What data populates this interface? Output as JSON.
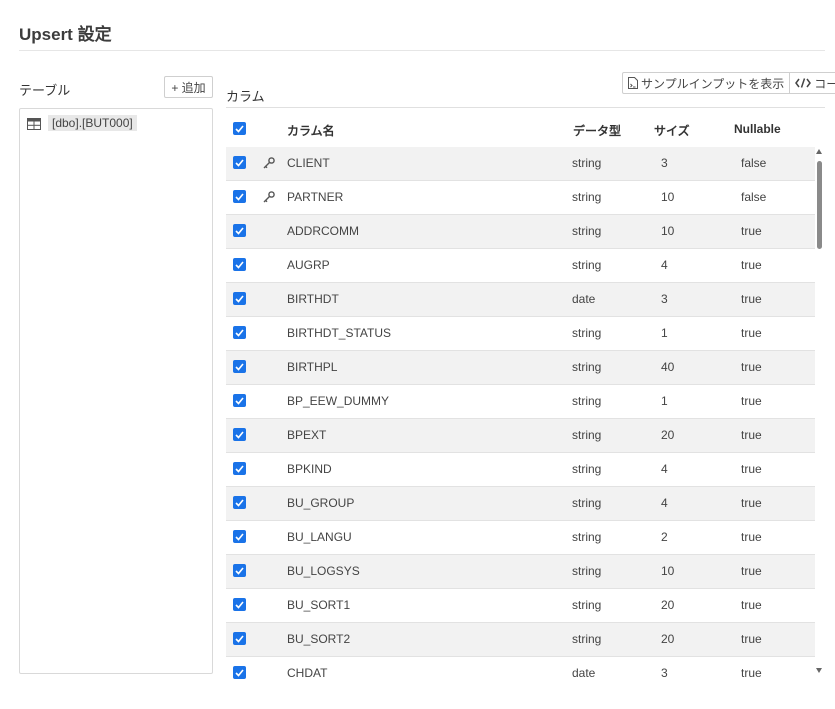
{
  "title": "Upsert 設定",
  "tables": {
    "label": "テーブル",
    "add_button": "+ 追加",
    "items": [
      "[dbo].[BUT000]"
    ]
  },
  "columns": {
    "label": "カラム",
    "sample_input_button": "サンプルインプットを表示",
    "code_button": "コード",
    "headers": {
      "name": "カラム名",
      "type": "データ型",
      "size": "サイズ",
      "nullable": "Nullable"
    },
    "rows": [
      {
        "name": "CLIENT",
        "type": "string",
        "size": "3",
        "nullable": "false",
        "key": true,
        "checked": true
      },
      {
        "name": "PARTNER",
        "type": "string",
        "size": "10",
        "nullable": "false",
        "key": true,
        "checked": true
      },
      {
        "name": "ADDRCOMM",
        "type": "string",
        "size": "10",
        "nullable": "true",
        "key": false,
        "checked": true
      },
      {
        "name": "AUGRP",
        "type": "string",
        "size": "4",
        "nullable": "true",
        "key": false,
        "checked": true
      },
      {
        "name": "BIRTHDT",
        "type": "date",
        "size": "3",
        "nullable": "true",
        "key": false,
        "checked": true
      },
      {
        "name": "BIRTHDT_STATUS",
        "type": "string",
        "size": "1",
        "nullable": "true",
        "key": false,
        "checked": true
      },
      {
        "name": "BIRTHPL",
        "type": "string",
        "size": "40",
        "nullable": "true",
        "key": false,
        "checked": true
      },
      {
        "name": "BP_EEW_DUMMY",
        "type": "string",
        "size": "1",
        "nullable": "true",
        "key": false,
        "checked": true
      },
      {
        "name": "BPEXT",
        "type": "string",
        "size": "20",
        "nullable": "true",
        "key": false,
        "checked": true
      },
      {
        "name": "BPKIND",
        "type": "string",
        "size": "4",
        "nullable": "true",
        "key": false,
        "checked": true
      },
      {
        "name": "BU_GROUP",
        "type": "string",
        "size": "4",
        "nullable": "true",
        "key": false,
        "checked": true
      },
      {
        "name": "BU_LANGU",
        "type": "string",
        "size": "2",
        "nullable": "true",
        "key": false,
        "checked": true
      },
      {
        "name": "BU_LOGSYS",
        "type": "string",
        "size": "10",
        "nullable": "true",
        "key": false,
        "checked": true
      },
      {
        "name": "BU_SORT1",
        "type": "string",
        "size": "20",
        "nullable": "true",
        "key": false,
        "checked": true
      },
      {
        "name": "BU_SORT2",
        "type": "string",
        "size": "20",
        "nullable": "true",
        "key": false,
        "checked": true
      },
      {
        "name": "CHDAT",
        "type": "date",
        "size": "3",
        "nullable": "true",
        "key": false,
        "checked": true
      }
    ]
  },
  "colors": {
    "accent": "#1a73e8",
    "row_alt": "#f2f2f2",
    "border": "#d9d9d9"
  },
  "icons": {
    "table": "table-grid-icon",
    "key": "key-icon",
    "sample": "document-icon",
    "code": "code-brackets-icon"
  }
}
